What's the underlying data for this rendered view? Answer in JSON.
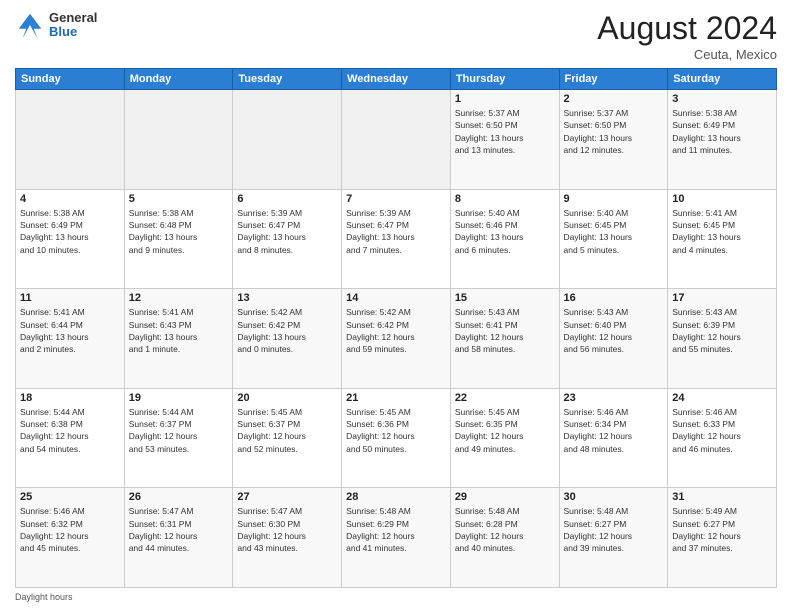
{
  "header": {
    "logo_general": "General",
    "logo_blue": "Blue",
    "month_year": "August 2024",
    "location": "Ceuta, Mexico"
  },
  "days_of_week": [
    "Sunday",
    "Monday",
    "Tuesday",
    "Wednesday",
    "Thursday",
    "Friday",
    "Saturday"
  ],
  "footer": {
    "daylight_label": "Daylight hours"
  },
  "weeks": [
    [
      {
        "day": "",
        "info": ""
      },
      {
        "day": "",
        "info": ""
      },
      {
        "day": "",
        "info": ""
      },
      {
        "day": "",
        "info": ""
      },
      {
        "day": "1",
        "info": "Sunrise: 5:37 AM\nSunset: 6:50 PM\nDaylight: 13 hours\nand 13 minutes."
      },
      {
        "day": "2",
        "info": "Sunrise: 5:37 AM\nSunset: 6:50 PM\nDaylight: 13 hours\nand 12 minutes."
      },
      {
        "day": "3",
        "info": "Sunrise: 5:38 AM\nSunset: 6:49 PM\nDaylight: 13 hours\nand 11 minutes."
      }
    ],
    [
      {
        "day": "4",
        "info": "Sunrise: 5:38 AM\nSunset: 6:49 PM\nDaylight: 13 hours\nand 10 minutes."
      },
      {
        "day": "5",
        "info": "Sunrise: 5:38 AM\nSunset: 6:48 PM\nDaylight: 13 hours\nand 9 minutes."
      },
      {
        "day": "6",
        "info": "Sunrise: 5:39 AM\nSunset: 6:47 PM\nDaylight: 13 hours\nand 8 minutes."
      },
      {
        "day": "7",
        "info": "Sunrise: 5:39 AM\nSunset: 6:47 PM\nDaylight: 13 hours\nand 7 minutes."
      },
      {
        "day": "8",
        "info": "Sunrise: 5:40 AM\nSunset: 6:46 PM\nDaylight: 13 hours\nand 6 minutes."
      },
      {
        "day": "9",
        "info": "Sunrise: 5:40 AM\nSunset: 6:45 PM\nDaylight: 13 hours\nand 5 minutes."
      },
      {
        "day": "10",
        "info": "Sunrise: 5:41 AM\nSunset: 6:45 PM\nDaylight: 13 hours\nand 4 minutes."
      }
    ],
    [
      {
        "day": "11",
        "info": "Sunrise: 5:41 AM\nSunset: 6:44 PM\nDaylight: 13 hours\nand 2 minutes."
      },
      {
        "day": "12",
        "info": "Sunrise: 5:41 AM\nSunset: 6:43 PM\nDaylight: 13 hours\nand 1 minute."
      },
      {
        "day": "13",
        "info": "Sunrise: 5:42 AM\nSunset: 6:42 PM\nDaylight: 13 hours\nand 0 minutes."
      },
      {
        "day": "14",
        "info": "Sunrise: 5:42 AM\nSunset: 6:42 PM\nDaylight: 12 hours\nand 59 minutes."
      },
      {
        "day": "15",
        "info": "Sunrise: 5:43 AM\nSunset: 6:41 PM\nDaylight: 12 hours\nand 58 minutes."
      },
      {
        "day": "16",
        "info": "Sunrise: 5:43 AM\nSunset: 6:40 PM\nDaylight: 12 hours\nand 56 minutes."
      },
      {
        "day": "17",
        "info": "Sunrise: 5:43 AM\nSunset: 6:39 PM\nDaylight: 12 hours\nand 55 minutes."
      }
    ],
    [
      {
        "day": "18",
        "info": "Sunrise: 5:44 AM\nSunset: 6:38 PM\nDaylight: 12 hours\nand 54 minutes."
      },
      {
        "day": "19",
        "info": "Sunrise: 5:44 AM\nSunset: 6:37 PM\nDaylight: 12 hours\nand 53 minutes."
      },
      {
        "day": "20",
        "info": "Sunrise: 5:45 AM\nSunset: 6:37 PM\nDaylight: 12 hours\nand 52 minutes."
      },
      {
        "day": "21",
        "info": "Sunrise: 5:45 AM\nSunset: 6:36 PM\nDaylight: 12 hours\nand 50 minutes."
      },
      {
        "day": "22",
        "info": "Sunrise: 5:45 AM\nSunset: 6:35 PM\nDaylight: 12 hours\nand 49 minutes."
      },
      {
        "day": "23",
        "info": "Sunrise: 5:46 AM\nSunset: 6:34 PM\nDaylight: 12 hours\nand 48 minutes."
      },
      {
        "day": "24",
        "info": "Sunrise: 5:46 AM\nSunset: 6:33 PM\nDaylight: 12 hours\nand 46 minutes."
      }
    ],
    [
      {
        "day": "25",
        "info": "Sunrise: 5:46 AM\nSunset: 6:32 PM\nDaylight: 12 hours\nand 45 minutes."
      },
      {
        "day": "26",
        "info": "Sunrise: 5:47 AM\nSunset: 6:31 PM\nDaylight: 12 hours\nand 44 minutes."
      },
      {
        "day": "27",
        "info": "Sunrise: 5:47 AM\nSunset: 6:30 PM\nDaylight: 12 hours\nand 43 minutes."
      },
      {
        "day": "28",
        "info": "Sunrise: 5:48 AM\nSunset: 6:29 PM\nDaylight: 12 hours\nand 41 minutes."
      },
      {
        "day": "29",
        "info": "Sunrise: 5:48 AM\nSunset: 6:28 PM\nDaylight: 12 hours\nand 40 minutes."
      },
      {
        "day": "30",
        "info": "Sunrise: 5:48 AM\nSunset: 6:27 PM\nDaylight: 12 hours\nand 39 minutes."
      },
      {
        "day": "31",
        "info": "Sunrise: 5:49 AM\nSunset: 6:27 PM\nDaylight: 12 hours\nand 37 minutes."
      }
    ]
  ]
}
